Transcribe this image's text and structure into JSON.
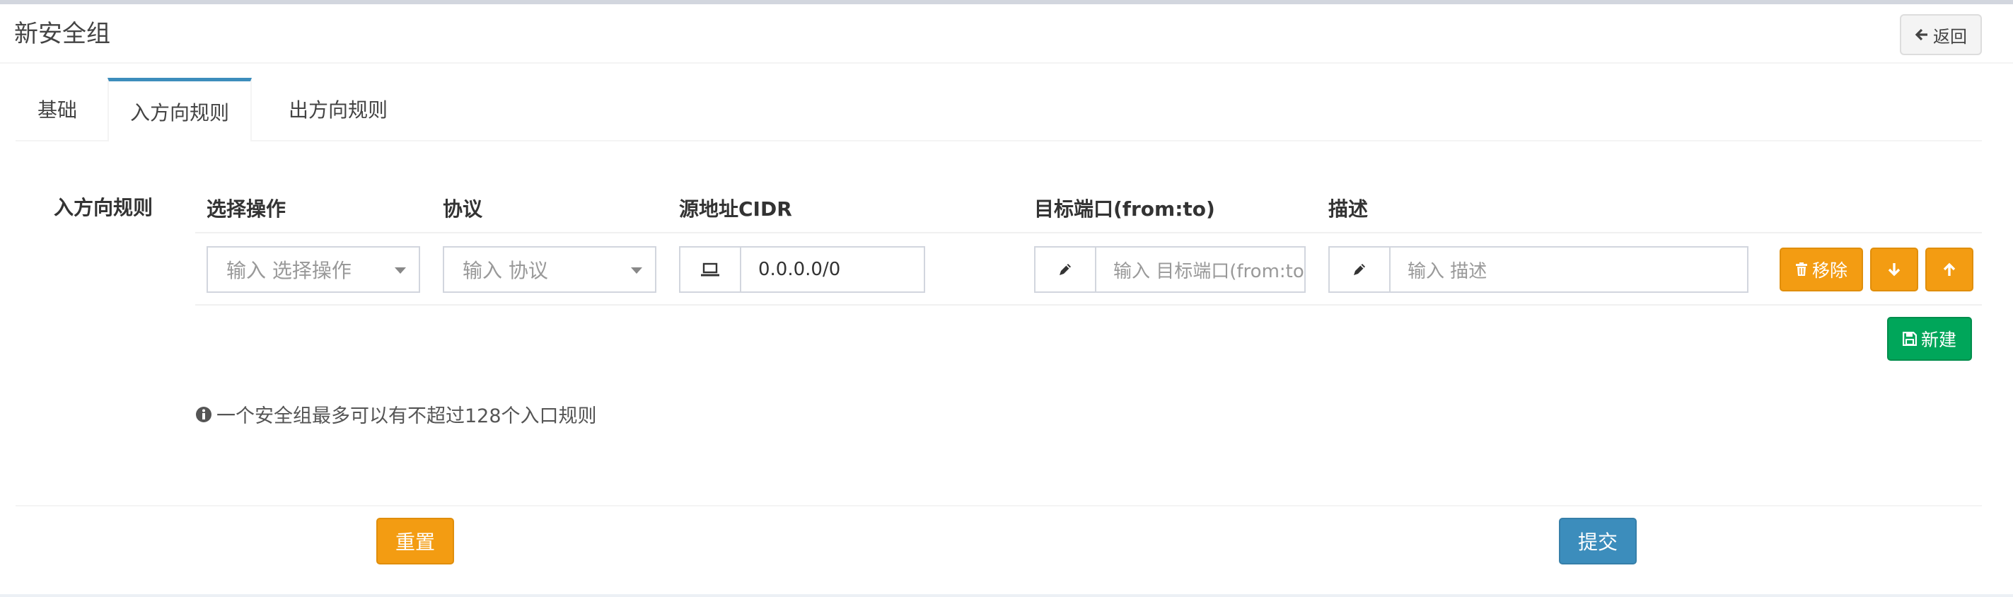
{
  "header": {
    "title": "新安全组",
    "back_label": "返回"
  },
  "tabs": [
    {
      "label": "基础",
      "active": false
    },
    {
      "label": "入方向规则",
      "active": true
    },
    {
      "label": "出方向规则",
      "active": false
    }
  ],
  "rules": {
    "section_label": "入方向规则",
    "columns": [
      "选择操作",
      "协议",
      "源地址CIDR",
      "目标端口(from:to)",
      "描述"
    ],
    "row": {
      "action_placeholder": "输入 选择操作",
      "protocol_placeholder": "输入 协议",
      "source_cidr_value": "0.0.0.0/0",
      "dest_port_placeholder": "输入 目标端口(from:to)",
      "description_placeholder": "输入 描述",
      "remove_label": "移除"
    },
    "new_label": "新建",
    "hint": "一个安全组最多可以有不超过128个入口规则"
  },
  "footer": {
    "reset_label": "重置",
    "submit_label": "提交"
  },
  "colors": {
    "warning": "#f39c12",
    "success": "#00a65a",
    "primary": "#3c8dbc",
    "tab_active_border": "#3c8dbc"
  },
  "icons": {
    "back": "arrow-left-icon",
    "laptop": "laptop-icon",
    "pencil": "pencil-icon",
    "trash": "trash-icon",
    "down": "arrow-down-icon",
    "up": "arrow-up-icon",
    "save": "save-icon",
    "info": "info-circle-icon"
  }
}
